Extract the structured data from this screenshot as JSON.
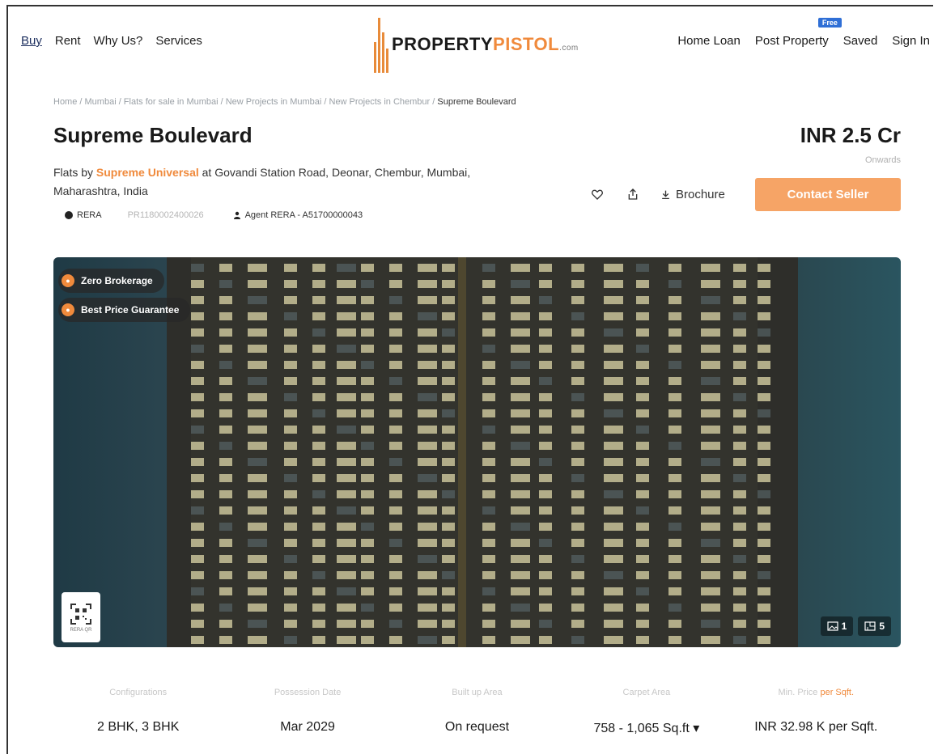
{
  "header": {
    "nav_left": [
      "Buy",
      "Rent",
      "Why Us?",
      "Services"
    ],
    "logo_part1": "PROPERTY",
    "logo_part2": "PISTOL",
    "logo_suffix": ".com",
    "nav_right": {
      "home_loan": "Home Loan",
      "post_property": "Post Property",
      "free_badge": "Free",
      "saved": "Saved",
      "sign_in": "Sign In"
    }
  },
  "breadcrumb": {
    "path": "Home / Mumbai / Flats for sale in Mumbai / New Projects in Mumbai / New Projects in Chembur / ",
    "current": "Supreme Boulevard"
  },
  "project": {
    "title": "Supreme Boulevard",
    "price": "INR 2.5 Cr",
    "price_note": "Onwards",
    "subline_prefix": "Flats by ",
    "developer": "Supreme Universal",
    "subline_suffix": " at Govandi Station Road, Deonar, Chembur, Mumbai, Maharashtra, India",
    "rera_label": "RERA",
    "rera_number": "PR1180002400026",
    "agent_rera": "Agent RERA - A51700000043"
  },
  "actions": {
    "brochure": "Brochure",
    "contact": "Contact Seller"
  },
  "hero": {
    "badge_1": "Zero Brokerage",
    "badge_2": "Best Price Guarantee",
    "qr_label": "RERA QR",
    "image_count": "1",
    "floorplan_count": "5"
  },
  "specs": [
    {
      "label": "Configurations",
      "value": "2 BHK, 3 BHK"
    },
    {
      "label": "Possession Date",
      "value": "Mar 2029"
    },
    {
      "label": "Built up Area",
      "value": "On request"
    },
    {
      "label": "Carpet Area",
      "value": "758 - 1,065 Sq.ft ▾"
    },
    {
      "label_prefix": "Min. Price ",
      "label_hl": "per Sqft.",
      "value": "INR 32.98 K per Sqft."
    }
  ],
  "colors": {
    "accent": "#f08a3c",
    "button": "#f6a466",
    "nav_active": "#1c2e5e"
  }
}
